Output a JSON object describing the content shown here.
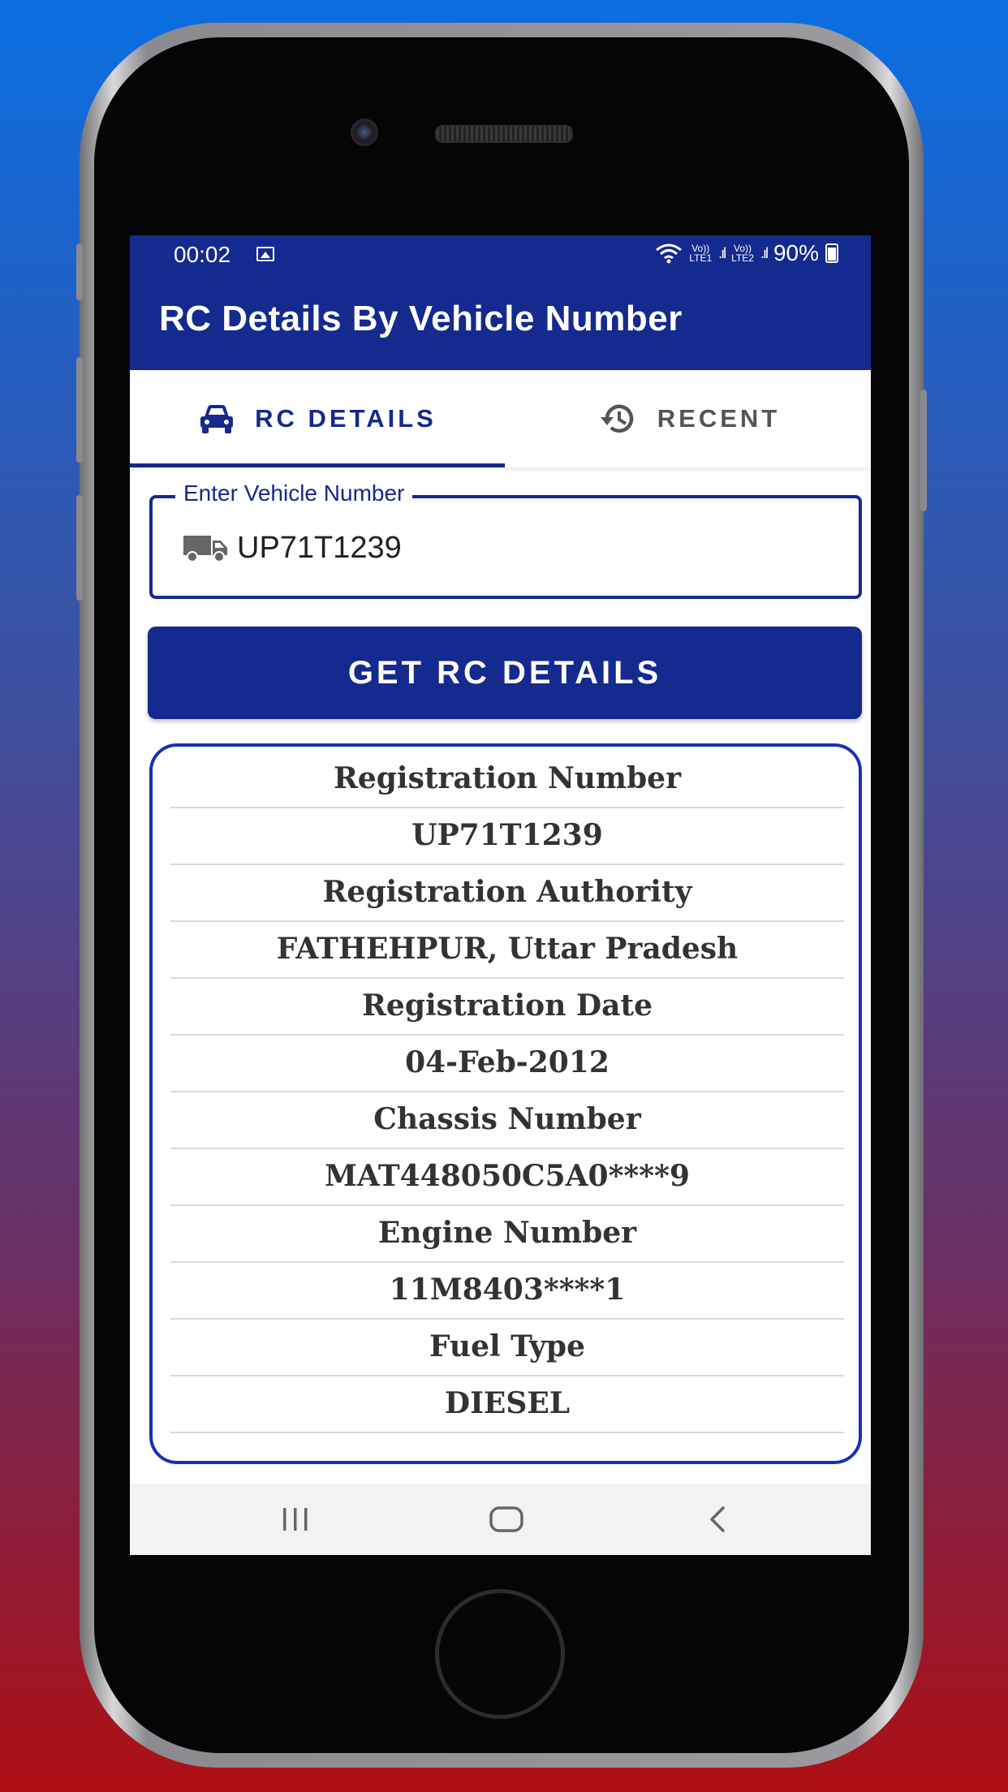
{
  "status_bar": {
    "time": "00:02",
    "lte1": "Vo))\nLTE1",
    "lte2": "Vo))\nLTE2",
    "battery_text": "90%",
    "icons": [
      "image-icon",
      "wifi-icon",
      "signal-icon",
      "battery-icon"
    ]
  },
  "app_bar": {
    "title": "RC Details By Vehicle Number"
  },
  "tabs": [
    {
      "label": "RC DETAILS",
      "icon": "car-icon",
      "selected": true
    },
    {
      "label": "RECENT",
      "icon": "history-icon",
      "selected": false
    }
  ],
  "search": {
    "label": "Enter Vehicle Number",
    "value": "UP71T1239",
    "icon": "truck-icon"
  },
  "get_button": {
    "label": "GET RC DETAILS"
  },
  "details": [
    "Registration Number",
    "UP71T1239",
    "Registration Authority",
    "FATHEHPUR, Uttar Pradesh",
    "Registration Date",
    "04-Feb-2012",
    "Chassis Number",
    "MAT448050C5A0****9",
    "Engine Number",
    "11M8403****1",
    "Fuel Type",
    "DIESEL"
  ],
  "nav_bar": {
    "icons": [
      "recent-apps-icon",
      "home-icon",
      "back-icon"
    ]
  },
  "colors": {
    "primary": "#142a8e",
    "card_border": "#1730b8",
    "background_top": "#0a6ee2",
    "background_bottom": "#ad0f14"
  }
}
